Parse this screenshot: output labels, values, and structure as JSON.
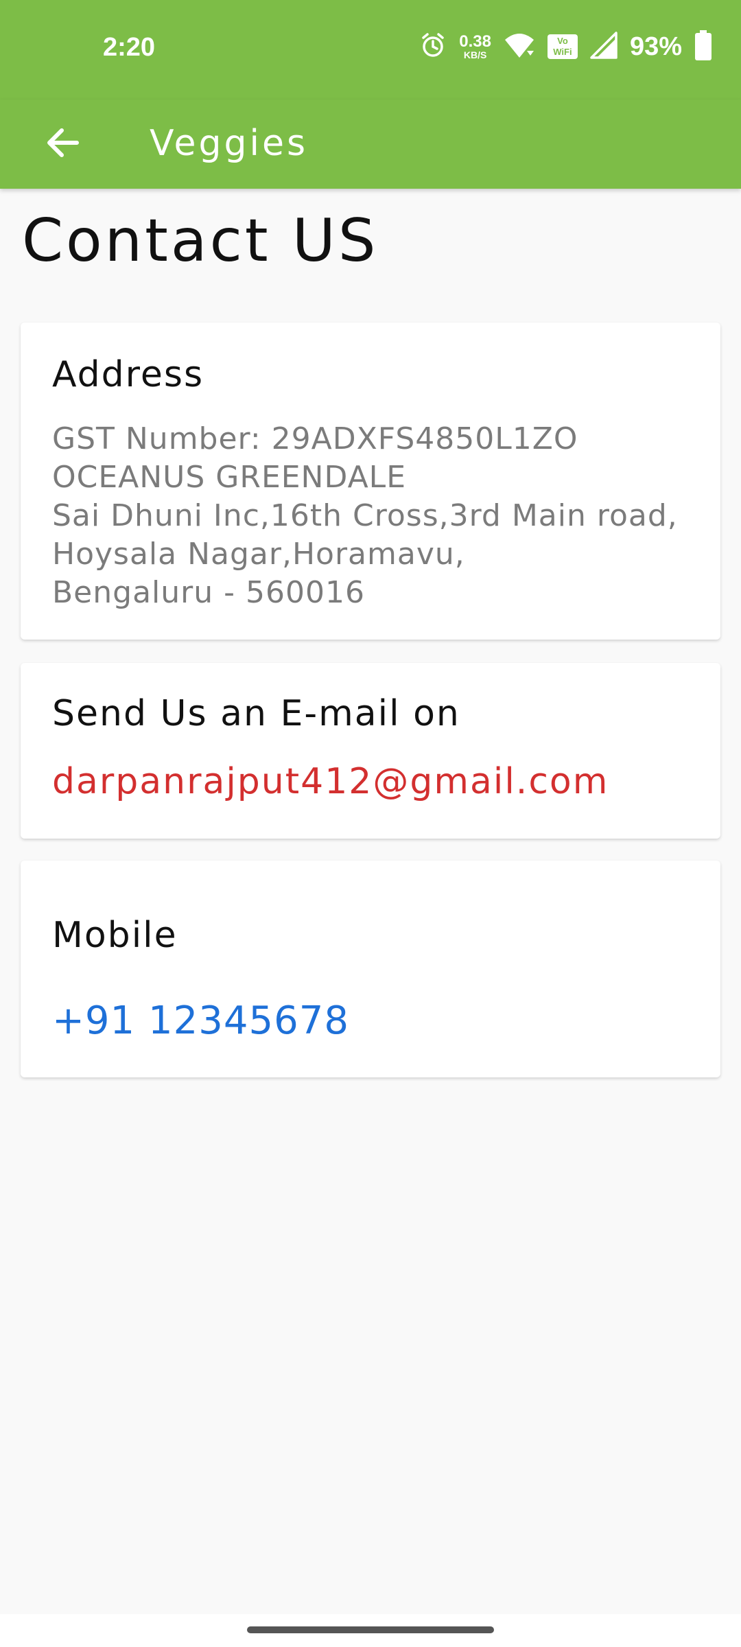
{
  "status_bar": {
    "time": "2:20",
    "net_speed_value": "0.38",
    "net_speed_unit": "KB/S",
    "vowifi_top": "Vo",
    "vowifi_bottom": "WiFi",
    "battery": "93%",
    "icons": [
      "alarm-icon",
      "wifi-icon",
      "vowifi-icon",
      "cellular-signal-icon",
      "battery-icon"
    ]
  },
  "app_bar": {
    "title": "Veggies",
    "back_icon": "arrow-back-icon",
    "color": "#7dbd47"
  },
  "page": {
    "heading": "Contact US"
  },
  "address_card": {
    "title": "Address",
    "lines": [
      "GST Number: 29ADXFS4850L1ZO",
      "OCEANUS GREENDALE",
      "Sai Dhuni Inc,16th Cross,3rd Main road,",
      "Hoysala Nagar,Horamavu,",
      "Bengaluru - 560016"
    ]
  },
  "email_card": {
    "title": "Send Us an E-mail on",
    "email": "darpanrajput412@gmail.com",
    "email_color": "#d32f2f"
  },
  "mobile_card": {
    "title": "Mobile",
    "phone": "+91 12345678",
    "phone_color": "#1e70d8"
  }
}
